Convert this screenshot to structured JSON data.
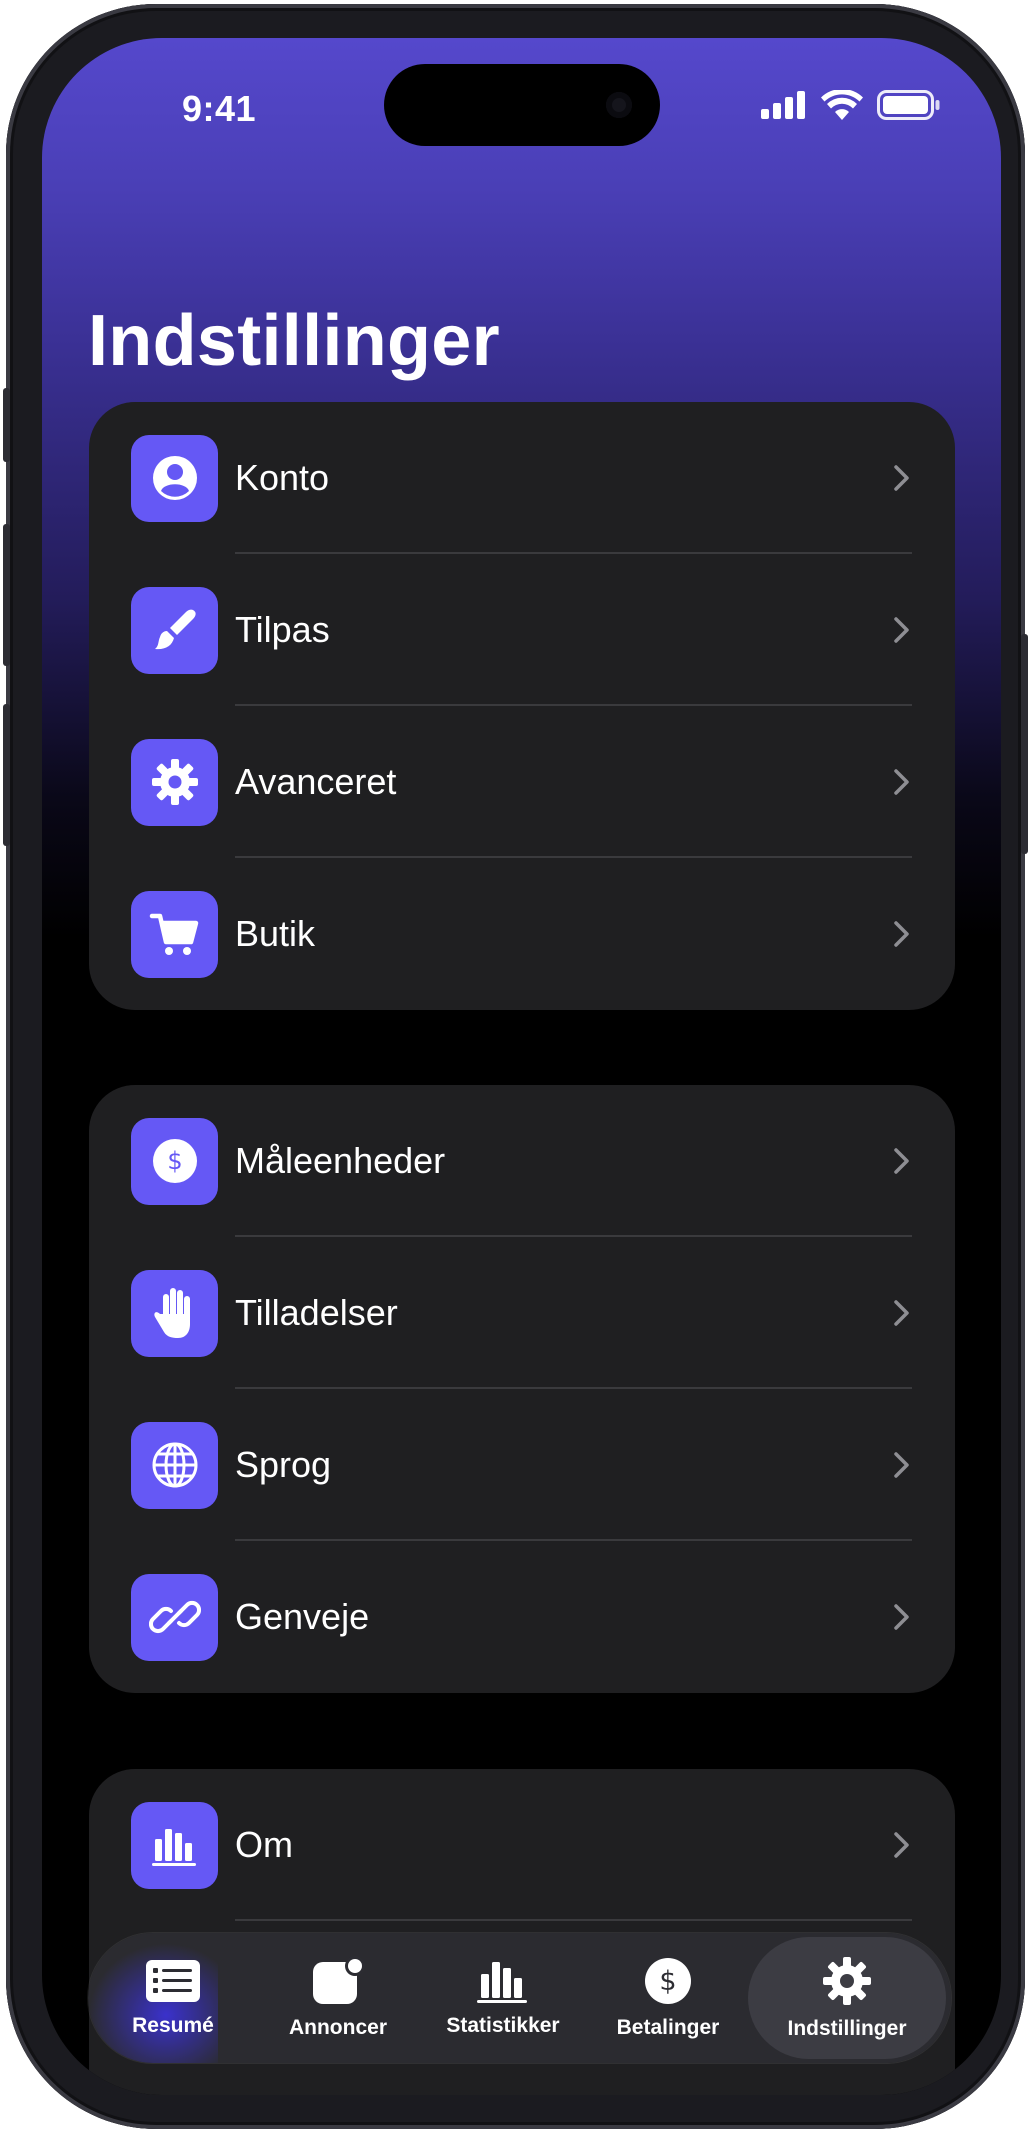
{
  "status_bar": {
    "time": "9:41"
  },
  "page": {
    "title": "Indstillinger"
  },
  "colors": {
    "accent": "#6558F5",
    "card": "#1F1F21",
    "header_gradient_top": "#5548CC"
  },
  "groups": [
    {
      "items": [
        {
          "label": "Konto",
          "icon": "person-circle-icon"
        },
        {
          "label": "Tilpas",
          "icon": "paintbrush-icon"
        },
        {
          "label": "Avanceret",
          "icon": "gear-icon"
        },
        {
          "label": "Butik",
          "icon": "cart-icon"
        }
      ]
    },
    {
      "items": [
        {
          "label": "Måleenheder",
          "icon": "dollar-circle-icon"
        },
        {
          "label": "Tilladelser",
          "icon": "hand-icon"
        },
        {
          "label": "Sprog",
          "icon": "globe-icon"
        },
        {
          "label": "Genveje",
          "icon": "link-icon"
        }
      ]
    },
    {
      "items": [
        {
          "label": "Om",
          "icon": "bar-chart-icon"
        }
      ]
    }
  ],
  "tab_bar": {
    "active": "Indstillinger",
    "tabs": [
      {
        "label": "Resumé",
        "icon": "list-icon"
      },
      {
        "label": "Annoncer",
        "icon": "notification-badge-icon"
      },
      {
        "label": "Statistikker",
        "icon": "bar-chart-icon"
      },
      {
        "label": "Betalinger",
        "icon": "dollar-circle-icon"
      },
      {
        "label": "Indstillinger",
        "icon": "gear-icon"
      }
    ]
  }
}
